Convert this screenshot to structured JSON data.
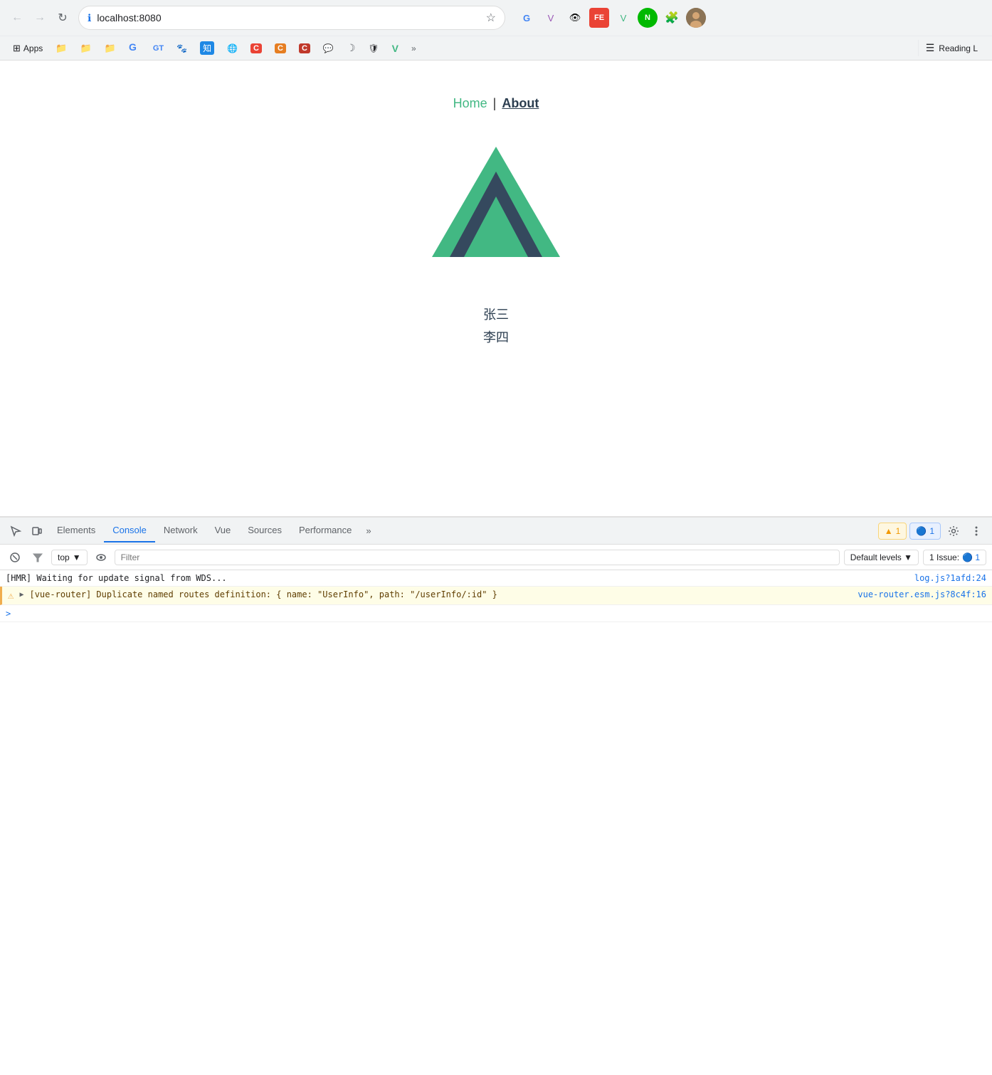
{
  "browser": {
    "address": "localhost:8080",
    "back_btn": "←",
    "forward_btn": "→",
    "refresh_btn": "↻",
    "star": "★",
    "bookmarks": [
      {
        "id": "apps",
        "label": "Apps",
        "icon": "⊞"
      },
      {
        "id": "folder1",
        "label": "",
        "icon": "📁"
      },
      {
        "id": "folder2",
        "label": "",
        "icon": "📁"
      },
      {
        "id": "folder3",
        "label": "",
        "icon": "📁"
      },
      {
        "id": "google",
        "label": "",
        "icon": "G",
        "type": "google"
      },
      {
        "id": "translate",
        "label": "",
        "icon": "GT"
      },
      {
        "id": "paw",
        "label": "",
        "icon": "🐾"
      },
      {
        "id": "zh",
        "label": "",
        "icon": "知"
      },
      {
        "id": "globe",
        "label": "",
        "icon": "🌐"
      },
      {
        "id": "c1",
        "label": "",
        "icon": "C",
        "type": "red"
      },
      {
        "id": "c2",
        "label": "",
        "icon": "C",
        "type": "orange"
      },
      {
        "id": "c3",
        "label": "",
        "icon": "C",
        "type": "red2"
      },
      {
        "id": "chat",
        "label": "",
        "icon": "💬"
      },
      {
        "id": "crescent",
        "label": "",
        "icon": "☽"
      },
      {
        "id": "shield",
        "label": "",
        "icon": "🛡"
      },
      {
        "id": "vue",
        "label": "",
        "icon": "V",
        "type": "green"
      }
    ],
    "more_label": "»",
    "reading_list_label": "Reading L"
  },
  "page": {
    "nav": {
      "home_label": "Home",
      "separator": "|",
      "about_label": "About"
    },
    "users": [
      "张三",
      "李四"
    ]
  },
  "devtools": {
    "tabs": [
      {
        "id": "elements",
        "label": "Elements",
        "active": false
      },
      {
        "id": "console",
        "label": "Console",
        "active": true
      },
      {
        "id": "network",
        "label": "Network",
        "active": false
      },
      {
        "id": "vue",
        "label": "Vue",
        "active": false
      },
      {
        "id": "sources",
        "label": "Sources",
        "active": false
      },
      {
        "id": "performance",
        "label": "Performance",
        "active": false
      }
    ],
    "more_label": "»",
    "warn_badge": "▲ 1",
    "info_badge": "🔵 1",
    "console": {
      "top_label": "top",
      "filter_placeholder": "Filter",
      "default_levels_label": "Default levels ▼",
      "issue_label": "1 Issue:",
      "issue_count": "🔵 1",
      "messages": [
        {
          "id": "hmr",
          "type": "normal",
          "text": "[HMR] Waiting for update signal from WDS...",
          "link": "log.js?1afd:24",
          "has_arrow": false,
          "has_warn": false
        },
        {
          "id": "vue-router-warn",
          "type": "warn",
          "text": "[vue-router] Duplicate named routes definition: { name: \"UserInfo\", path: \"/userInfo/:id\" }",
          "link": "vue-router.esm.js?8c4f:16",
          "has_arrow": true,
          "has_warn": true
        }
      ],
      "prompt_icon": ">"
    }
  }
}
